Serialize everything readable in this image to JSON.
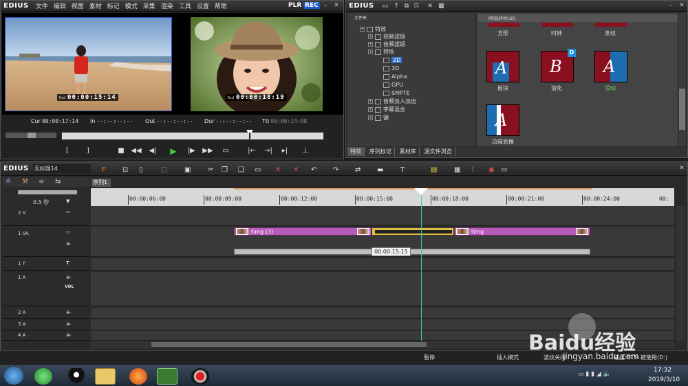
{
  "player": {
    "app_logo": "EDIUS",
    "menu": [
      "文件",
      "编辑",
      "视图",
      "素材",
      "标记",
      "模式",
      "采集",
      "渲染",
      "工具",
      "设置",
      "帮助"
    ],
    "plr_label": "PLR",
    "rec_label": "REC",
    "left_timecode_prefix": "Rcd",
    "left_timecode": "00:00:15:14",
    "right_timecode_prefix": "Rcd",
    "right_timecode": "00:00:18:19",
    "cur_label": "Cur",
    "cur_value": "00:00:17:14",
    "in_label": "In",
    "in_value": "--:--:--:--",
    "out_label": "Out",
    "out_value": "--:--:--:--",
    "dur_label": "Dur",
    "dur_value": "--:--:--:--",
    "ttl_label": "Ttl",
    "ttl_value": "00:00:24:08"
  },
  "effects": {
    "app_logo": "EDIUS",
    "tree_header": "文件夹",
    "path": "\\特效\\转场\\2D\\",
    "tree": [
      {
        "label": "特效",
        "level": 0
      },
      {
        "label": "视频滤镜",
        "level": 1
      },
      {
        "label": "音频滤镜",
        "level": 1
      },
      {
        "label": "转场",
        "level": 1
      },
      {
        "label": "2D",
        "level": 2,
        "selected": true
      },
      {
        "label": "3D",
        "level": 2
      },
      {
        "label": "Alpha",
        "level": 2
      },
      {
        "label": "GPU",
        "level": 2
      },
      {
        "label": "SMPTE",
        "level": 2
      },
      {
        "label": "音频淡入淡出",
        "level": 1
      },
      {
        "label": "字幕混合",
        "level": 1
      },
      {
        "label": "键",
        "level": 1
      }
    ],
    "top_labels": [
      "方形",
      "时钟",
      "条纹"
    ],
    "tiles": [
      {
        "letter": "A",
        "label": "板块"
      },
      {
        "letter": "B",
        "label": "溶化",
        "badge": "D"
      },
      {
        "letter": "A",
        "label": "滑动"
      },
      {
        "letter": "A",
        "label": "边缘划像"
      }
    ],
    "tabs": [
      "特效",
      "序列标记",
      "素材库",
      "源文件浏览"
    ]
  },
  "timeline": {
    "app_logo": "EDIUS",
    "project_name": "无标题14",
    "sequence_tab": "序列1",
    "zoom_label": "0.5 秒",
    "ruler": [
      "00:00:06:00",
      "00:00:09:00",
      "00:00:12:00",
      "00:00:15:00",
      "00:00:18:00",
      "00:00:21:00",
      "00:00:24:00"
    ],
    "ruler_tail": "00:",
    "tracks": [
      {
        "name": "2 V"
      },
      {
        "name": "1 VA"
      },
      {
        "name": "1 T"
      },
      {
        "name": "1 A",
        "vol": "VOL"
      },
      {
        "name": "2 A"
      },
      {
        "name": "3 A"
      },
      {
        "name": "4 A"
      }
    ],
    "clip1_name": "timg (3)",
    "clip2_name": "timg",
    "tooltip": "00:00:15:15"
  },
  "status": {
    "pause": "暂停",
    "insert_mode": "插入模式",
    "ripple": "波纹关闭",
    "disk": "磁盘:61% 被使用(D:)"
  },
  "taskbar": {
    "time": "17:32",
    "date": "2019/3/10"
  },
  "watermark": {
    "brand": "Baidu经验",
    "url": "jingyan.baidu.com"
  },
  "colors": {
    "clip": "#b75ab8",
    "timecode_bg": "#000000",
    "selected": "#2f6fd0",
    "playhead": "#ffffff",
    "tile": "#8a1020"
  }
}
